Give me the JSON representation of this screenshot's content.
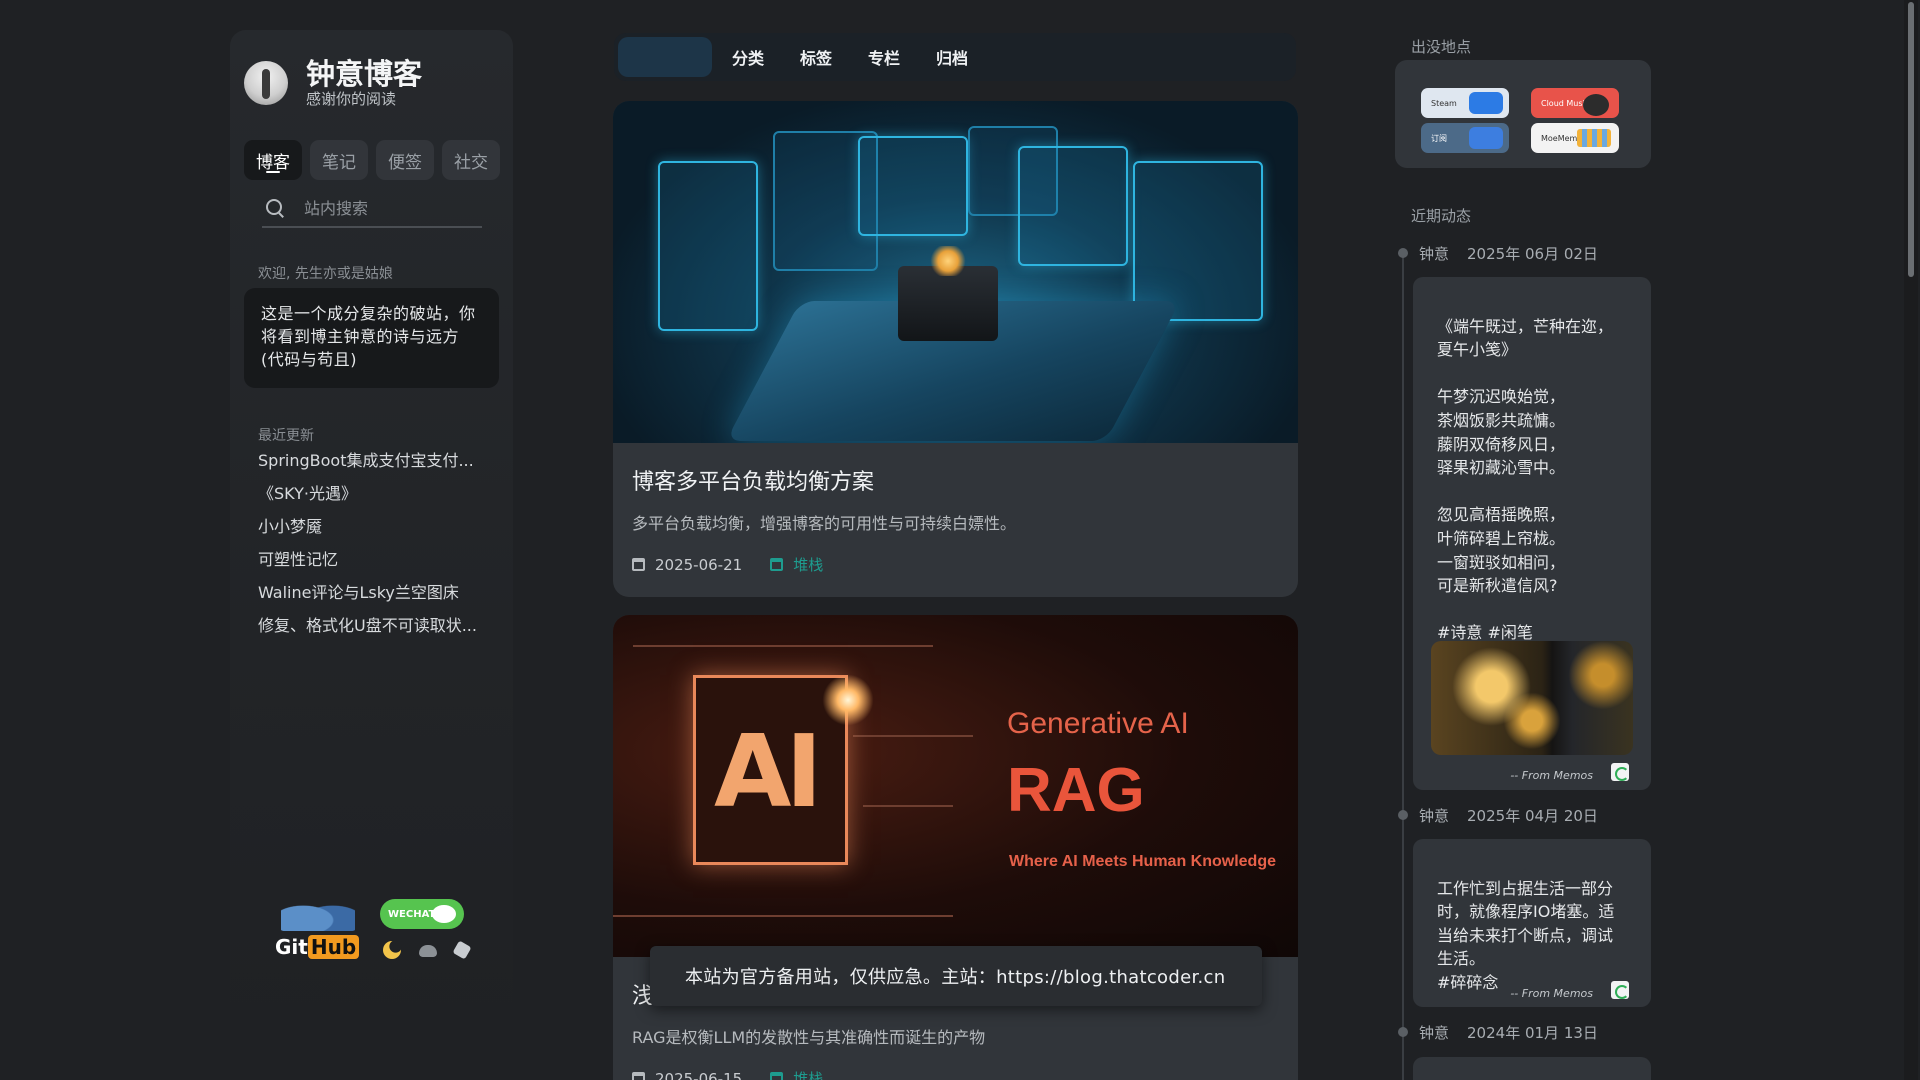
{
  "site": {
    "title": "钟意博客",
    "subtitle": "感谢你的阅读"
  },
  "tabs": [
    "博客",
    "笔记",
    "便签",
    "社交"
  ],
  "search": {
    "placeholder": "站内搜索"
  },
  "welcome": {
    "label": "欢迎, 先生亦或是姑娘",
    "text": "这是一个成分复杂的破站，你将看到博主钟意的诗与远方(代码与苟且)"
  },
  "recent": {
    "label": "最近更新",
    "items": [
      "SpringBoot集成支付宝支付...",
      "《SKY·光遇》",
      "小小梦魇",
      "可塑性记忆",
      "Waline评论与Lsky兰空图床",
      "修复、格式化U盘不可读取状..."
    ]
  },
  "badges": {
    "github": "Git",
    "github_hub": "Hub",
    "wechat": "WECHAT"
  },
  "nav": [
    "分类",
    "标签",
    "专栏",
    "归档"
  ],
  "posts": [
    {
      "title": "博客多平台负载均衡方案",
      "desc": "多平台负载均衡，增强博客的可用性与可持续白嫖性。",
      "date": "2025-06-21",
      "tag": "堆栈"
    },
    {
      "title": "浅",
      "desc": "RAG是权衡LLM的发散性与其准确性而诞生的产物",
      "date": "2025-06-15",
      "tag": "堆栈",
      "cover_text": {
        "gen": "Generative AI",
        "rag": "RAG",
        "where": "Where AI Meets Human Knowledge",
        "chip": "AI"
      }
    }
  ],
  "toast": "本站为官方备用站，仅供应急。主站：https://blog.thatcoder.cn",
  "right": {
    "sponsor_label": "出没地点",
    "sponsors": [
      "Steam",
      "Cloud Music",
      "订阅",
      "MoeMem"
    ],
    "activity_label": "近期动态",
    "memos": [
      {
        "author": "钟意",
        "date": "2025年 06月 02日",
        "text": "《端午既过，芒种在迩，夏午小笺》\n\n午梦沉迟唤始觉，\n茶烟饭影共疏慵。\n藤阴双倚移风日，\n驿果初藏沁雪中。\n\n忽见高梧摇晚照，\n叶筛碎碧上帘栊。\n一窗斑驳如相问，\n可是新秋遣信风?\n\n#诗意 #闲笔",
        "from": "-- From Memos"
      },
      {
        "author": "钟意",
        "date": "2025年 04月 20日",
        "text": "工作忙到占据生活一部分时，就像程序IO堵塞。适当给未来打个断点，调试生活。\n#碎碎念",
        "from": "-- From Memos"
      },
      {
        "author": "钟意",
        "date": "2024年 01月 13日",
        "text": "",
        "from": ""
      }
    ]
  },
  "colors": {
    "accent": "#1e9c8f",
    "background": "#1f2124",
    "card": "#31353a"
  }
}
